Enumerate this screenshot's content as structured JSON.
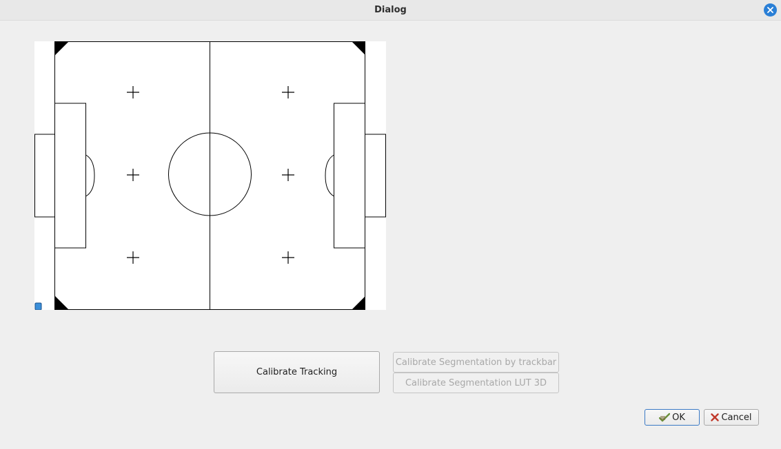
{
  "window": {
    "title": "Dialog"
  },
  "buttons": {
    "calibrate_tracking": "Calibrate Tracking",
    "calibrate_seg_trackbar": "Calibrate Segmentation by trackbar",
    "calibrate_seg_lut": "Calibrate Segmentation LUT 3D",
    "ok": "OK",
    "cancel": "Cancel"
  },
  "icons": {
    "close": "close-icon",
    "ok": "ok-check-icon",
    "cancel": "cancel-x-icon"
  },
  "colors": {
    "accent": "#2a7fd6",
    "robot_marker": "#3b8fd9",
    "cancel_icon": "#c0392b",
    "ok_icon": "#6a8f3a"
  }
}
